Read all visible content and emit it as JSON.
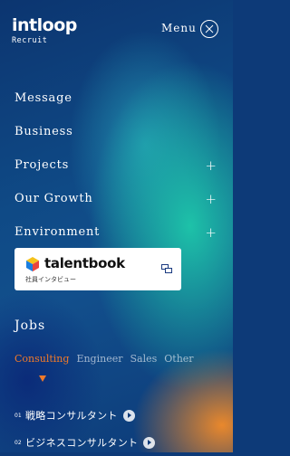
{
  "header": {
    "logo_main": "intloop",
    "logo_sub": "Recruit",
    "menu_label": "Menu"
  },
  "nav": {
    "items": [
      {
        "label": "Message",
        "expandable": false
      },
      {
        "label": "Business",
        "expandable": false
      },
      {
        "label": "Projects",
        "expandable": true
      },
      {
        "label": "Our Growth",
        "expandable": true
      },
      {
        "label": "Environment",
        "expandable": true
      }
    ],
    "plus_symbol": "+"
  },
  "talentbook": {
    "name": "talentbook",
    "subtitle": "社員インタビュー"
  },
  "jobs": {
    "title": "Jobs",
    "tabs": [
      {
        "label": "Consulting",
        "active": true
      },
      {
        "label": "Engineer",
        "active": false
      },
      {
        "label": "Sales",
        "active": false
      },
      {
        "label": "Other",
        "active": false
      }
    ],
    "list": [
      {
        "number": "01",
        "label": "戦略コンサルタント"
      },
      {
        "number": "02",
        "label": "ビジネスコンサルタント"
      }
    ]
  },
  "colors": {
    "accent": "#f07a2a",
    "background": "#0d3a78"
  }
}
